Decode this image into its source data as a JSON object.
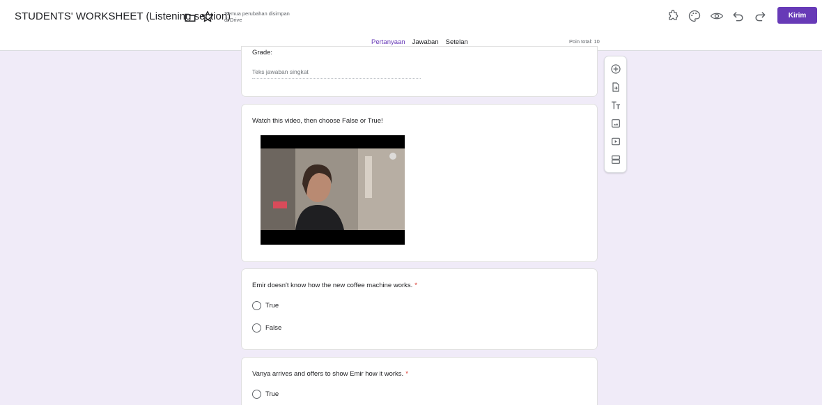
{
  "header": {
    "title": "STUDENTS' WORKSHEET (Listening section)",
    "save_status_line1": "Semua perubahan disimpan",
    "save_status_line2": "di Drive",
    "send_label": "Kirim"
  },
  "tabs": [
    {
      "label": "Pertanyaan",
      "active": true
    },
    {
      "label": "Jawaban",
      "active": false
    },
    {
      "label": "Setelan",
      "active": false
    }
  ],
  "points_total": "Poin total: 10",
  "cards": {
    "grade": {
      "label": "Grade:",
      "answer_placeholder": "Teks jawaban singkat"
    },
    "video": {
      "text": "Watch this video, then choose False or True!"
    },
    "q1": {
      "text": "Emir doesn't know how the new coffee machine works.",
      "required_mark": "*",
      "options": [
        "True",
        "False"
      ]
    },
    "q2": {
      "text": "Vanya arrives and offers to show Emir how it works.",
      "required_mark": "*",
      "options": [
        "True"
      ]
    }
  },
  "icons": {
    "header": [
      "folder-icon",
      "star-icon",
      "addon-icon",
      "palette-icon",
      "preview-eye-icon",
      "undo-icon",
      "redo-icon"
    ],
    "toolbar": [
      "add-question-icon",
      "import-questions-icon",
      "add-title-icon",
      "add-image-icon",
      "add-video-icon",
      "add-section-icon"
    ]
  },
  "colors": {
    "accent": "#673ab7",
    "background": "#f0ebf8",
    "required": "#d93025"
  }
}
